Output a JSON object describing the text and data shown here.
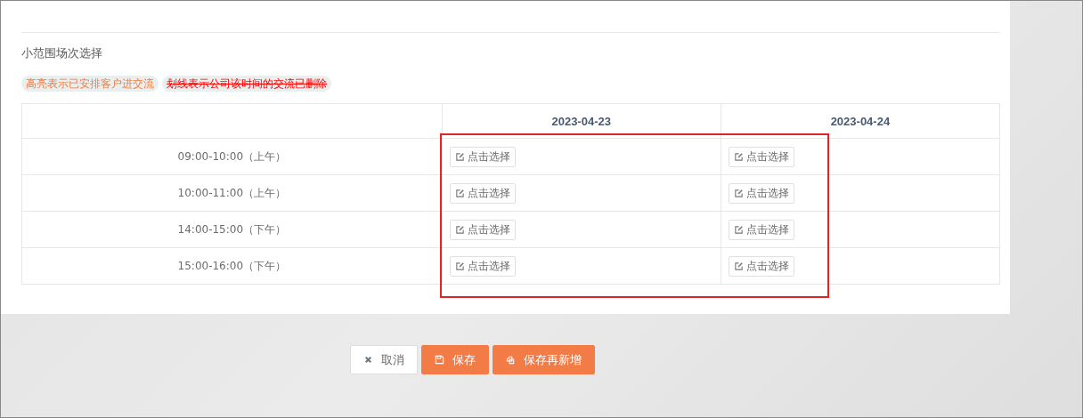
{
  "section_title": "小范围场次选择",
  "legend": [
    {
      "text": "高亮表示已安排客户进交流",
      "kind": "highlight"
    },
    {
      "text": "划线表示公司该时间的交流已删除",
      "kind": "strike"
    }
  ],
  "table": {
    "columns": [
      "2023-04-23",
      "2023-04-24"
    ],
    "rows": [
      {
        "time": "09:00-10:00（上午）",
        "cells": [
          "点击选择",
          "点击选择"
        ]
      },
      {
        "time": "10:00-11:00（上午）",
        "cells": [
          "点击选择",
          "点击选择"
        ]
      },
      {
        "time": "14:00-15:00（下午）",
        "cells": [
          "点击选择",
          "点击选择"
        ]
      },
      {
        "time": "15:00-16:00（下午）",
        "cells": [
          "点击选择",
          "点击选择"
        ]
      }
    ]
  },
  "buttons": [
    {
      "label": "取消",
      "kind": "cancel"
    },
    {
      "label": "保存",
      "kind": "save"
    },
    {
      "label": "保存再新增",
      "kind": "save-new"
    }
  ]
}
